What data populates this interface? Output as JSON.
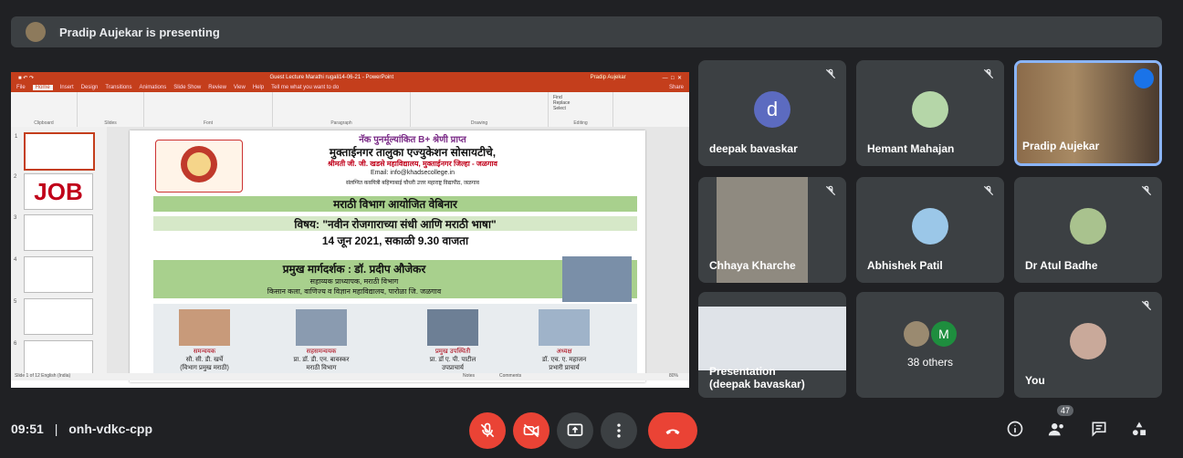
{
  "banner": {
    "text": "Pradip Aujekar is presenting"
  },
  "ppt": {
    "window_title": "Guest Lecture Marathi rugali14-06-21 - PowerPoint",
    "user": "Pradip Aujekar",
    "tabs": [
      "File",
      "Home",
      "Insert",
      "Design",
      "Transitions",
      "Animations",
      "Slide Show",
      "Review",
      "View",
      "Help"
    ],
    "tell_me": "Tell me what you want to do",
    "share": "Share",
    "groups": [
      "Clipboard",
      "Slides",
      "Font",
      "Paragraph",
      "Drawing",
      "Editing"
    ],
    "editing": [
      "Find",
      "Replace",
      "Select"
    ],
    "status": "Slide 1 of 12   English (India)",
    "notes": "Notes",
    "comments": "Comments",
    "zoom": "80%",
    "thumb_nums": [
      "1",
      "2",
      "3",
      "4",
      "5",
      "6"
    ],
    "thumb_job": "JOB"
  },
  "slide": {
    "naac": "नॅक पुनर्मूल्यांकित B+ श्रेणी प्राप्त",
    "society": "मुक्ताईनगर तालुका एज्युकेशन सोसायटीचे,",
    "college": "श्रीमती जी. जी. खडसे महाविद्यालय, मुक्ताईनगर जिल्हा - जळगाव",
    "email": "Email: info@khadsecollege.in",
    "affil": "संलग्नित कवयित्री बहिणाबाई चौधरी उत्तर महाराष्ट्र विद्यापीठ, जळगाव",
    "dept": "मराठी विभाग आयोजित वेबिनार",
    "topic": "विषय: \"नवीन रोजगाराच्या संधी आणि मराठी भाषा\"",
    "date": "14 जून 2021, सकाळी 9.30 वाजता",
    "guide": "प्रमुख मार्गदर्शक : डॉ. प्रदीप औजेकर",
    "guide_role": "सहाय्यक प्राध्यापक, मराठी विभाग",
    "guide_college": "किसान कला, वाणिज्य व विज्ञान महाविद्यालय, पारोळा जि. जळगाव",
    "people": [
      {
        "role": "समन्वयक",
        "name": "सौ. सी. डी. खर्चे",
        "extra": "(विभाग प्रमुख मराठी)"
      },
      {
        "role": "सहसमन्वयक",
        "name": "प्रा. डॉ. डी. एन. बावस्कर",
        "extra": "मराठी विभाग"
      },
      {
        "role": "प्रमुख उपस्थिती",
        "name": "प्रा. डॉ ए. पी. पाटील",
        "extra": "उपप्राचार्य"
      },
      {
        "role": "अध्यक्ष",
        "name": "डॉ. एच. ए. महाजन",
        "extra": "प्रभारी प्राचार्य"
      }
    ]
  },
  "participants": [
    {
      "name": "deepak bavaskar",
      "initial": "d",
      "avatar_color": "#5c6bc0"
    },
    {
      "name": "Hemant Mahajan"
    },
    {
      "name": "Pradip Aujekar"
    },
    {
      "name": "Chhaya Kharche"
    },
    {
      "name": "Abhishek Patil"
    },
    {
      "name": "Dr Atul Badhe"
    },
    {
      "name": "Presentation\n(deepak bavaskar)"
    },
    {
      "name": "38 others",
      "initial": "M",
      "avatar_color": "#1e8e3e"
    },
    {
      "name": "You"
    }
  ],
  "bottom": {
    "time": "09:51",
    "separator": "|",
    "code": "onh-vdkc-cpp",
    "people_count": "47"
  },
  "colors": {
    "danger": "#ea4335",
    "accent": "#8ab4f8",
    "ppt": "#c43e1c"
  }
}
